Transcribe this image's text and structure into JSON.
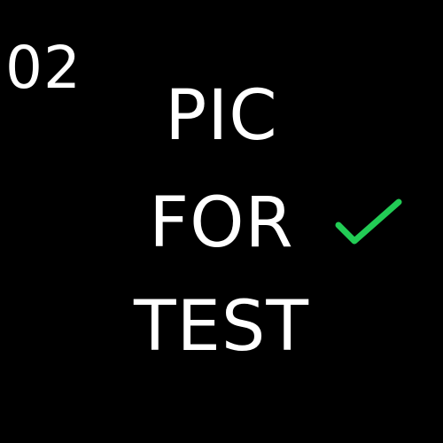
{
  "page_number": "02",
  "headline": {
    "lines": [
      "PIC",
      "FOR",
      "TEST"
    ]
  },
  "status_icon": {
    "name": "check-icon",
    "color": "#22cc55"
  },
  "colors": {
    "background": "#000000",
    "text": "#ffffff"
  }
}
